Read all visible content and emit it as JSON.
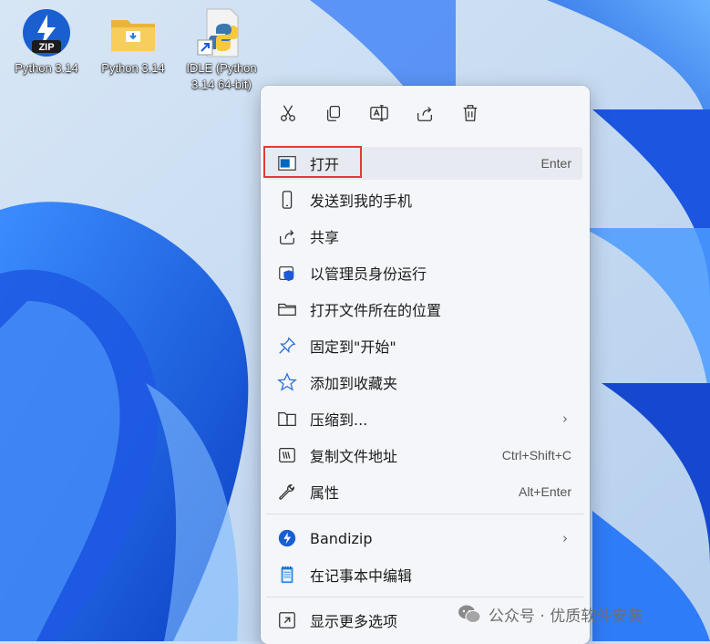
{
  "desktop": {
    "icons": [
      {
        "label": "Python 3.14",
        "icon": "zip-archive-icon"
      },
      {
        "label": "Python 3.14",
        "icon": "folder-icon"
      },
      {
        "label_line1": "IDLE (Python",
        "label_line2": "3.14 64-bit)",
        "icon": "python-shortcut-icon"
      }
    ]
  },
  "context_menu": {
    "quick_actions": [
      {
        "name": "cut",
        "icon": "scissors-icon"
      },
      {
        "name": "copy",
        "icon": "copy-icon"
      },
      {
        "name": "rename",
        "icon": "rename-icon"
      },
      {
        "name": "share",
        "icon": "share-icon"
      },
      {
        "name": "delete",
        "icon": "trash-icon"
      }
    ],
    "items": [
      {
        "label": "打开",
        "shortcut": "Enter",
        "icon": "window-icon"
      },
      {
        "label": "发送到我的手机",
        "icon": "phone-icon"
      },
      {
        "label": "共享",
        "icon": "share-icon"
      },
      {
        "label": "以管理员身份运行",
        "icon": "shield-icon"
      },
      {
        "label": "打开文件所在的位置",
        "icon": "folder-icon"
      },
      {
        "label": "固定到\"开始\"",
        "icon": "pin-icon"
      },
      {
        "label": "添加到收藏夹",
        "icon": "star-icon"
      },
      {
        "label": "压缩到...",
        "icon": "zip-folder-icon",
        "submenu": "›"
      },
      {
        "label": "复制文件地址",
        "shortcut": "Ctrl+Shift+C",
        "icon": "copy-path-icon"
      },
      {
        "label": "属性",
        "shortcut": "Alt+Enter",
        "icon": "wrench-icon"
      },
      {
        "label": "Bandizip",
        "icon": "bandizip-icon",
        "submenu": "›"
      },
      {
        "label": "在记事本中编辑",
        "icon": "notepad-icon"
      },
      {
        "label": "显示更多选项",
        "icon": "more-options-icon"
      }
    ]
  },
  "watermark": {
    "text": "公众号 · 优质软件安装"
  },
  "colors": {
    "accent": "#0067c0",
    "highlight_border": "#e23a3a",
    "menu_bg": "#f4f6f9"
  }
}
